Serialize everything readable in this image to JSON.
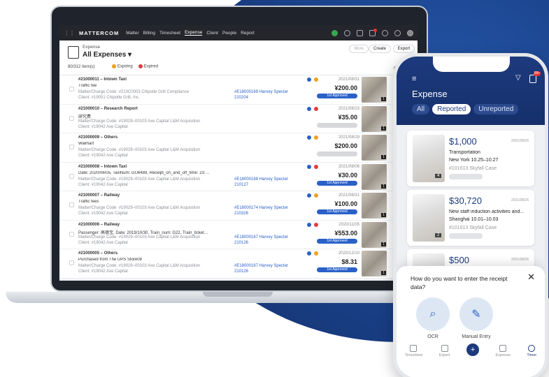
{
  "nav": {
    "brand": "MATTERCOM",
    "items": [
      "Matter",
      "Billing",
      "Timesheet",
      "Expense",
      "Client",
      "People",
      "Report"
    ]
  },
  "header": {
    "label": "Expense",
    "title": "All Expenses",
    "count": "80/312 Item(s)",
    "expiring": "Expiring",
    "expired": "Expired",
    "buttons": [
      "More",
      "Create",
      "Export"
    ]
  },
  "rows": [
    {
      "id": "#21000011 – Intown Taxi",
      "desc": "Traffic fee",
      "code": "Matter/Charge Code: #210C0003 Chipotle Grill Compliance",
      "client": "Client: #19051 Chipotle Grill, Inc.",
      "inv": "#E18000169 Harvey Specter",
      "inv2": "210204",
      "date": "2021/08/31",
      "amt": "¥200.00",
      "status": "1st Approved"
    },
    {
      "id": "#21000010 – Research Report",
      "desc": "研究费",
      "code": "Matter/Charge Code: #19029–00103 Axe Capital L&M Acquisition",
      "client": "Client: #19042 Axe Capital",
      "inv": "",
      "inv2": "",
      "date": "2021/08/23",
      "amt": "¥35.00",
      "status": ""
    },
    {
      "id": "#21000009 – Others",
      "desc": "Walmart",
      "code": "Matter/Charge Code: #19029–00103 Axe Capital L&M Acquisition",
      "client": "Client: #19042 Axe Capital",
      "inv": "",
      "inv2": "",
      "date": "2021/08/19",
      "amt": "$200.00",
      "status": ""
    },
    {
      "id": "#21000008 – Intown Taxi",
      "desc": "Date: 2020/06/05, TaxiNum: GU6489, Receipt_on_and_off_time: 23:…",
      "code": "Matter/Charge Code: #19029–00103 Axe Capital L&M Acquisition",
      "client": "Client: #19042 Axe Capital",
      "inv": "#E18000168 Harvey Specter",
      "inv2": "210127",
      "date": "2021/08/06",
      "amt": "¥30.00",
      "status": "1st Approved"
    },
    {
      "id": "#21000007 – Railway",
      "desc": "Traffic fees",
      "code": "Matter/Charge Code: #19029–00103 Axe Capital L&M Acquisition",
      "client": "Client: #19042 Axe Capital",
      "inv": "#E18000174 Harvey Specter",
      "inv2": "210326",
      "date": "2021/08/31",
      "amt": "¥100.00",
      "status": "1st Approved"
    },
    {
      "id": "#21000006 – Railway",
      "desc": "Passenger: 高德宝, Date: 2019/10/30, Train_num: G22, Train_ticket…",
      "code": "Matter/Charge Code: #19029–00103 Axe Capital L&M Acquisition",
      "client": "Client: #19042 Axe Capital",
      "inv": "#E18000167 Harvey Specter",
      "inv2": "210126",
      "date": "2020/11/05",
      "amt": "¥553.00",
      "status": "1st Approved"
    },
    {
      "id": "#21000005 – Others",
      "desc": "Purchased from The UPS Store08",
      "code": "Matter/Charge Code: #19029–00103 Axe Capital L&M Acquisition",
      "client": "Client: #19042 Axe Capital",
      "inv": "#E18000167 Harvey Specter",
      "inv2": "210126",
      "date": "2020/12/10",
      "amt": "$8.31",
      "status": "1st Approved"
    }
  ],
  "phone": {
    "title": "Expense",
    "tabs": [
      "All",
      "Reported",
      "Unreported"
    ],
    "badge": "99+",
    "cards": [
      {
        "amt": "$1,000",
        "date": "2021/08/26",
        "l1": "Transportation",
        "l2": "New York 10.25–10.27",
        "l3": "#101613 Skyfall Case",
        "cnt": "4"
      },
      {
        "amt": "$30,720",
        "date": "2021/08/26",
        "l1": "New staff induction activities and...",
        "l2": "Shanghai 10.01–10.03",
        "l3": "#101613 Skyfall Case",
        "cnt": "2"
      },
      {
        "amt": "$500",
        "date": "2021/08/26",
        "l1": "",
        "l2": "",
        "l3": "",
        "cnt": ""
      }
    ],
    "sheet": {
      "question": "How do you want to enter the receipt data?",
      "opt1": "OCR",
      "opt2": "Manual Entry"
    },
    "tabbar": [
      "Timesheet",
      "Expert",
      "",
      "Expense",
      "Timer"
    ]
  },
  "colors": {
    "primary": "#1d3a7d",
    "link": "#2a61c8",
    "expiring": "#f0a020",
    "expired": "#e33b3b"
  }
}
